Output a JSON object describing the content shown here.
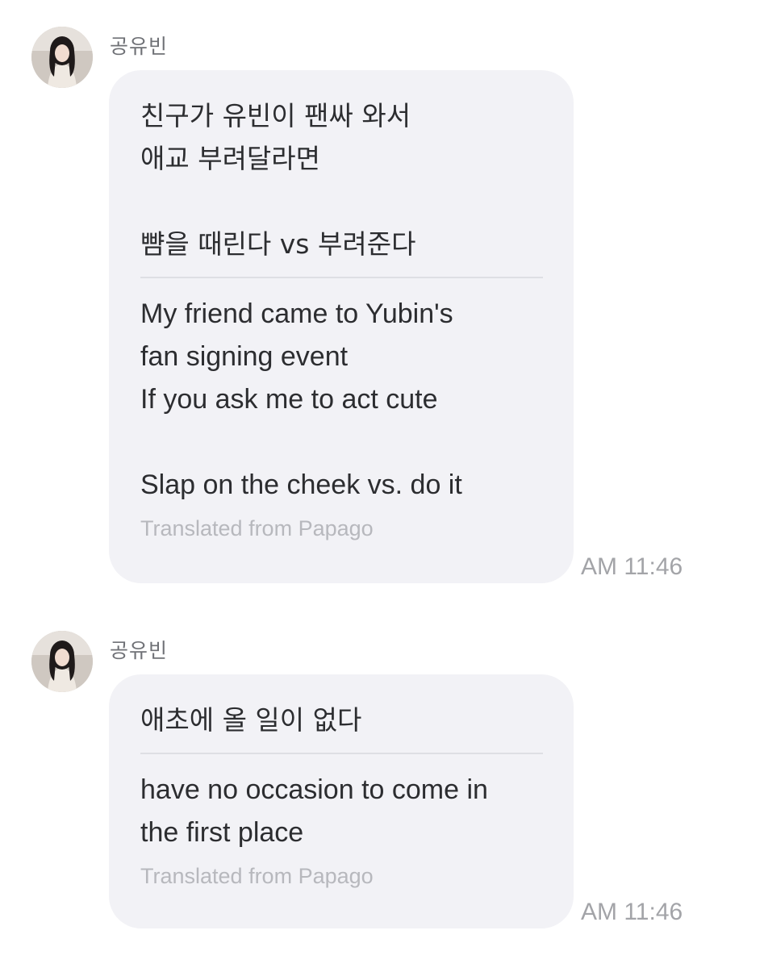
{
  "messages": [
    {
      "sender": "공유빈",
      "original": "친구가 유빈이 팬싸 와서\n애교 부려달라면\n\n뺨을 때린다 vs 부려준다",
      "translation": "My friend came to Yubin's\nfan signing event\nIf you ask me to act cute\n\nSlap on the cheek vs. do it",
      "caption": "Translated from Papago",
      "time": "AM 11:46"
    },
    {
      "sender": "공유빈",
      "original": "애초에 올 일이 없다",
      "translation": "have no occasion to come in\nthe first place",
      "caption": "Translated from Papago",
      "time": "AM 11:46"
    }
  ]
}
